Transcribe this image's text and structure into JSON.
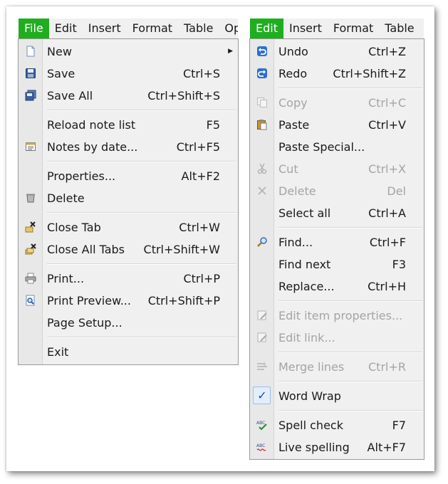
{
  "file_panel": {
    "menubar": [
      "File",
      "Edit",
      "Insert",
      "Format",
      "Table",
      "Opt"
    ],
    "active": "File",
    "items": [
      {
        "label": "New",
        "shortcut": "",
        "icon": "new-document-icon",
        "submenu": true
      },
      {
        "label": "Save",
        "shortcut": "Ctrl+S",
        "icon": "save-disk-icon"
      },
      {
        "label": "Save All",
        "shortcut": "Ctrl+Shift+S",
        "icon": "save-all-icon"
      },
      {
        "sep": true
      },
      {
        "label": "Reload note list",
        "shortcut": "F5",
        "icon": ""
      },
      {
        "label": "Notes by date...",
        "shortcut": "Ctrl+F5",
        "icon": "calendar-icon"
      },
      {
        "sep": true
      },
      {
        "label": "Properties...",
        "shortcut": "Alt+F2",
        "icon": ""
      },
      {
        "label": "Delete",
        "shortcut": "",
        "icon": "trash-icon"
      },
      {
        "sep": true
      },
      {
        "label": "Close Tab",
        "shortcut": "Ctrl+W",
        "icon": "close-tab-icon"
      },
      {
        "label": "Close All Tabs",
        "shortcut": "Ctrl+Shift+W",
        "icon": "close-all-tabs-icon"
      },
      {
        "sep": true
      },
      {
        "label": "Print...",
        "shortcut": "Ctrl+P",
        "icon": "printer-icon"
      },
      {
        "label": "Print Preview...",
        "shortcut": "Ctrl+Shift+P",
        "icon": "print-preview-icon"
      },
      {
        "label": "Page Setup...",
        "shortcut": "",
        "icon": ""
      },
      {
        "sep": true
      },
      {
        "label": "Exit",
        "shortcut": "",
        "icon": ""
      }
    ]
  },
  "edit_panel": {
    "menubar": [
      "Edit",
      "Insert",
      "Format",
      "Table",
      "O"
    ],
    "active": "Edit",
    "items": [
      {
        "label": "Undo",
        "shortcut": "Ctrl+Z",
        "icon": "undo-icon"
      },
      {
        "label": "Redo",
        "shortcut": "Ctrl+Shift+Z",
        "icon": "redo-icon"
      },
      {
        "sep": true
      },
      {
        "label": "Copy",
        "shortcut": "Ctrl+C",
        "icon": "copy-icon",
        "disabled": true
      },
      {
        "label": "Paste",
        "shortcut": "Ctrl+V",
        "icon": "paste-icon"
      },
      {
        "label": "Paste Special...",
        "shortcut": "",
        "icon": ""
      },
      {
        "label": "Cut",
        "shortcut": "Ctrl+X",
        "icon": "scissors-icon",
        "disabled": true
      },
      {
        "label": "Delete",
        "shortcut": "Del",
        "icon": "delete-x-icon",
        "disabled": true
      },
      {
        "label": "Select all",
        "shortcut": "Ctrl+A",
        "icon": ""
      },
      {
        "sep": true
      },
      {
        "label": "Find...",
        "shortcut": "Ctrl+F",
        "icon": "magnifier-icon"
      },
      {
        "label": "Find next",
        "shortcut": "F3",
        "icon": ""
      },
      {
        "label": "Replace...",
        "shortcut": "Ctrl+H",
        "icon": ""
      },
      {
        "sep": true
      },
      {
        "label": "Edit item properties...",
        "shortcut": "",
        "icon": "edit-properties-icon",
        "disabled": true
      },
      {
        "label": "Edit link...",
        "shortcut": "",
        "icon": "edit-link-icon",
        "disabled": true
      },
      {
        "sep": true
      },
      {
        "label": "Merge lines",
        "shortcut": "Ctrl+R",
        "icon": "merge-lines-icon",
        "disabled": true
      },
      {
        "sep": true
      },
      {
        "label": "Word Wrap",
        "shortcut": "",
        "icon": "checkmark-icon",
        "checked": true
      },
      {
        "sep": true
      },
      {
        "label": "Spell check",
        "shortcut": "F7",
        "icon": "spell-check-icon"
      },
      {
        "label": "Live spelling",
        "shortcut": "Alt+F7",
        "icon": "live-spelling-icon"
      }
    ]
  },
  "colors": {
    "menubar_active_bg": "#1fae1f",
    "menu_bg": "#f0f0f0",
    "disabled_text": "#a4a4a4"
  }
}
